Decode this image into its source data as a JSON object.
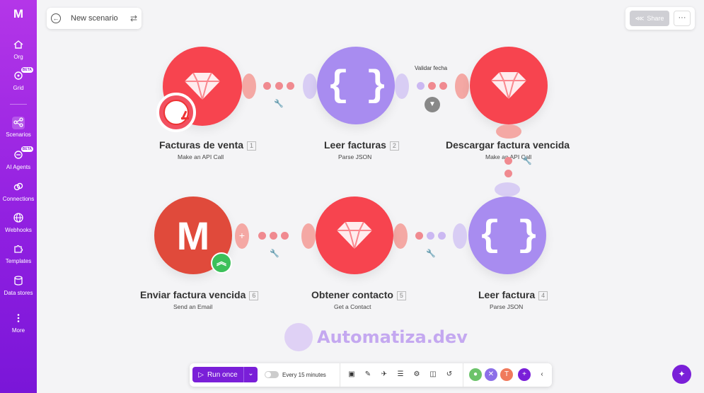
{
  "sidebar": {
    "logo": "M",
    "items": [
      {
        "label": "Org",
        "icon": "home-icon"
      },
      {
        "label": "Grid",
        "icon": "grid-icon",
        "badge": "BETA"
      },
      {
        "label": "Scenarios",
        "icon": "share-nodes-icon"
      },
      {
        "label": "AI Agents",
        "icon": "ai-agent-icon",
        "badge": "BETA"
      },
      {
        "label": "Connections",
        "icon": "link-icon"
      },
      {
        "label": "Webhooks",
        "icon": "globe-icon"
      },
      {
        "label": "Templates",
        "icon": "puzzle-icon"
      },
      {
        "label": "Data stores",
        "icon": "database-icon"
      },
      {
        "label": "More",
        "icon": "more-vertical-icon"
      }
    ]
  },
  "header": {
    "title": "New scenario",
    "share_label": "Share",
    "more_label": "···"
  },
  "modules": [
    {
      "name": "Facturas de venta",
      "num": "1",
      "sub": "Make an API Call"
    },
    {
      "name": "Leer facturas",
      "num": "2",
      "sub": "Parse JSON"
    },
    {
      "name": "Descargar factura vencida",
      "num": "3",
      "sub": "Make an API Call"
    },
    {
      "name": "Leer factura",
      "num": "4",
      "sub": "Parse JSON"
    },
    {
      "name": "Obtener contacto",
      "num": "5",
      "sub": "Get a Contact"
    },
    {
      "name": "Enviar factura vencida",
      "num": "6",
      "sub": "Send an Email"
    }
  ],
  "filter": {
    "label": "Validar fecha"
  },
  "watermark": "Automatiza.dev",
  "toolbar": {
    "run_label": "Run once",
    "schedule_label": "Every 15 minutes"
  },
  "colors": {
    "accent": "#7a1fd8",
    "module_red": "#f7444f",
    "module_purple": "#a88cf0"
  }
}
